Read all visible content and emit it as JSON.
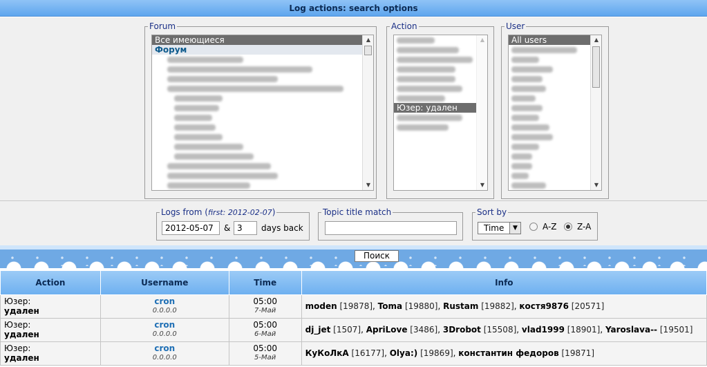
{
  "header": {
    "title": "Log actions: search options"
  },
  "forum": {
    "legend": "Forum",
    "options": [
      {
        "label": "Все имеющиеся",
        "selected": true
      },
      {
        "label": "Форум",
        "category": true
      }
    ]
  },
  "action": {
    "legend": "Action",
    "selected_option": "Юзер: удален"
  },
  "user": {
    "legend": "User",
    "options": [
      {
        "label": "All users",
        "selected": true
      }
    ]
  },
  "logs_from": {
    "legend_prefix": "Logs from",
    "legend_note": "first: 2012-02-07",
    "date_value": "2012-05-07",
    "amp": "&",
    "days_value": "3",
    "days_label": "days back"
  },
  "topic": {
    "legend": "Topic title match",
    "value": ""
  },
  "sort": {
    "legend": "Sort by",
    "selected": "Time",
    "az_label": "A-Z",
    "za_label": "Z-A",
    "checked": "Z-A"
  },
  "search_button": "Поиск",
  "table": {
    "headers": [
      "Action",
      "Username",
      "Time",
      "Info"
    ],
    "rows": [
      {
        "action_line1": "Юзер:",
        "action_line2": "удален",
        "user": "cron",
        "ip": "0.0.0.0",
        "time": "05:00",
        "date": "7-Май",
        "info": [
          {
            "name": "moden",
            "id": "[19878]"
          },
          {
            "name": "Toma",
            "id": "[19880]"
          },
          {
            "name": "Rustam",
            "id": "[19882]"
          },
          {
            "name": "костя9876",
            "id": "[20571]"
          }
        ]
      },
      {
        "action_line1": "Юзер:",
        "action_line2": "удален",
        "user": "cron",
        "ip": "0.0.0.0",
        "time": "05:00",
        "date": "6-Май",
        "info": [
          {
            "name": "dj_jet",
            "id": "[1507]"
          },
          {
            "name": "ApriLove",
            "id": "[3486]"
          },
          {
            "name": "3Drobot",
            "id": "[15508]"
          },
          {
            "name": "vlad1999",
            "id": "[18901]"
          },
          {
            "name": "Yaroslava--",
            "id": "[19501]"
          }
        ]
      },
      {
        "action_line1": "Юзер:",
        "action_line2": "удален",
        "user": "cron",
        "ip": "0.0.0.0",
        "time": "05:00",
        "date": "5-Май",
        "info": [
          {
            "name": "КуКоЛкА",
            "id": "[16177]"
          },
          {
            "name": "Olya:)",
            "id": "[19869]"
          },
          {
            "name": "константин федоров",
            "id": "[19871]"
          }
        ]
      }
    ]
  }
}
